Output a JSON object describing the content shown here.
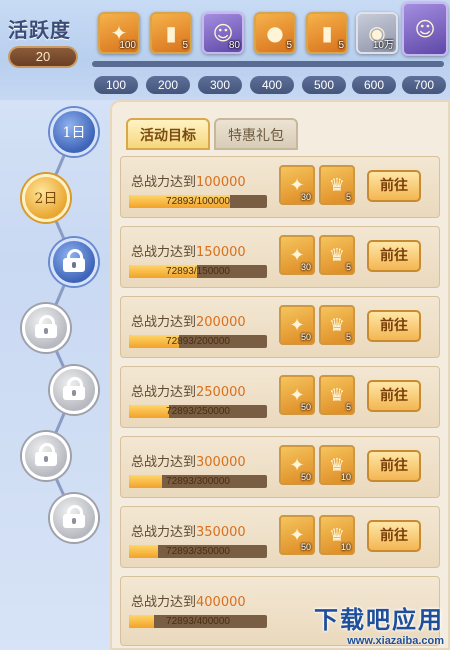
{
  "activity": {
    "title": "活跃度",
    "score": "20",
    "progress_fraction": 0.0
  },
  "top_rewards": [
    {
      "icon": "feather-icon",
      "count": "100",
      "style": "gold"
    },
    {
      "icon": "scroll-icon",
      "count": "5",
      "style": "gold"
    },
    {
      "icon": "portrait-icon",
      "count": "80",
      "style": "purple"
    },
    {
      "icon": "fire-orb-icon",
      "count": "5",
      "style": "gold"
    },
    {
      "icon": "scroll-icon",
      "count": "5",
      "style": "gold"
    },
    {
      "icon": "coin-icon",
      "count": "10万",
      "style": "grey"
    },
    {
      "icon": "character-portrait-icon",
      "count": "",
      "style": "purple"
    }
  ],
  "thresholds": [
    "100",
    "200",
    "300",
    "400",
    "500",
    "600",
    "700"
  ],
  "days": [
    {
      "label": "1日",
      "state": "blue"
    },
    {
      "label": "2日",
      "state": "gold"
    },
    {
      "label": "",
      "state": "blue-lock"
    },
    {
      "label": "",
      "state": "grey"
    },
    {
      "label": "",
      "state": "grey"
    },
    {
      "label": "",
      "state": "grey"
    },
    {
      "label": "",
      "state": "grey"
    }
  ],
  "tabs": {
    "active": "活动目标",
    "inactive": "特惠礼包"
  },
  "tasks": [
    {
      "prefix": "总战力达到",
      "target": "100000",
      "progress": "72893/100000",
      "fraction": 0.73,
      "rewards": [
        {
          "icon": "feather-icon",
          "count": "30"
        },
        {
          "icon": "helmet-icon",
          "count": "5"
        }
      ],
      "button": "前往"
    },
    {
      "prefix": "总战力达到",
      "target": "150000",
      "progress": "72893/150000",
      "fraction": 0.49,
      "rewards": [
        {
          "icon": "feather-icon",
          "count": "30"
        },
        {
          "icon": "helmet-icon",
          "count": "5"
        }
      ],
      "button": "前往"
    },
    {
      "prefix": "总战力达到",
      "target": "200000",
      "progress": "72893/200000",
      "fraction": 0.36,
      "rewards": [
        {
          "icon": "feather-icon",
          "count": "50"
        },
        {
          "icon": "helmet-icon",
          "count": "5"
        }
      ],
      "button": "前往"
    },
    {
      "prefix": "总战力达到",
      "target": "250000",
      "progress": "72893/250000",
      "fraction": 0.29,
      "rewards": [
        {
          "icon": "feather-icon",
          "count": "50"
        },
        {
          "icon": "helmet-icon",
          "count": "5"
        }
      ],
      "button": "前往"
    },
    {
      "prefix": "总战力达到",
      "target": "300000",
      "progress": "72893/300000",
      "fraction": 0.24,
      "rewards": [
        {
          "icon": "feather-icon",
          "count": "50"
        },
        {
          "icon": "helmet-icon",
          "count": "10"
        }
      ],
      "button": "前往"
    },
    {
      "prefix": "总战力达到",
      "target": "350000",
      "progress": "72893/350000",
      "fraction": 0.21,
      "rewards": [
        {
          "icon": "feather-icon",
          "count": "50"
        },
        {
          "icon": "helmet-icon",
          "count": "10"
        }
      ],
      "button": "前往"
    },
    {
      "prefix": "总战力达到",
      "target": "400000",
      "progress": "72893/400000",
      "fraction": 0.18,
      "rewards": [],
      "button": ""
    }
  ],
  "watermark": {
    "text": "下载吧应用",
    "url": "www.xiazaiba.com"
  }
}
